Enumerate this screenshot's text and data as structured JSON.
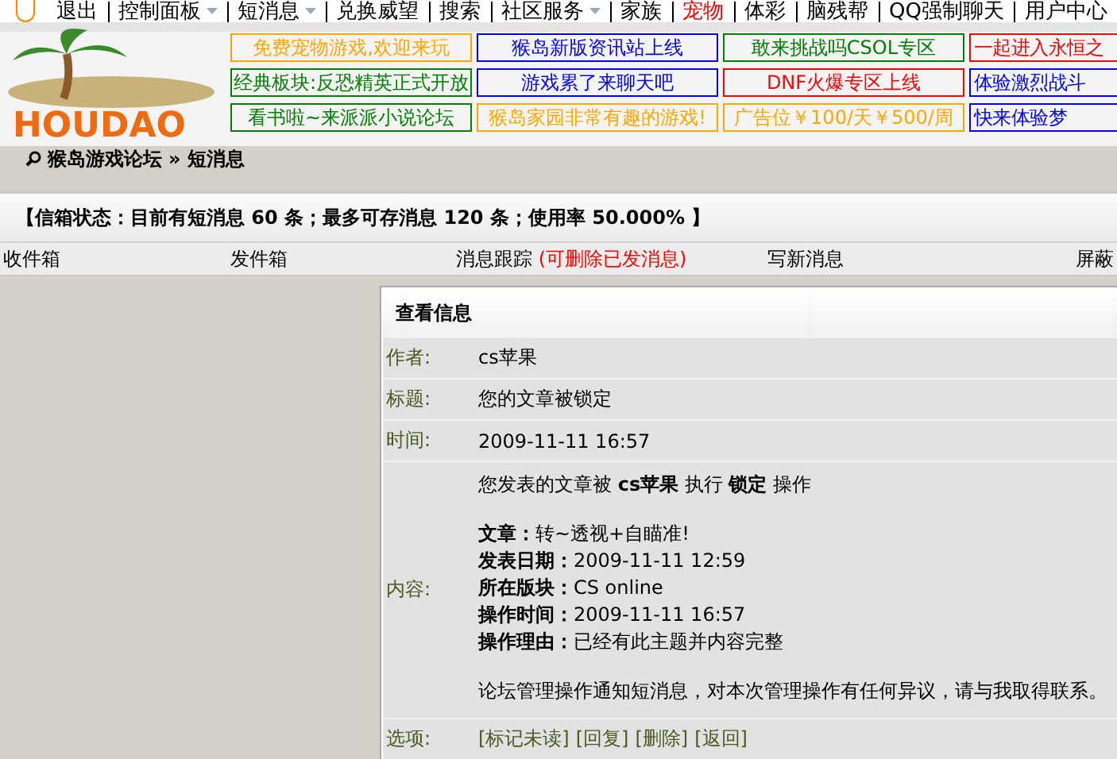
{
  "top_nav": [
    {
      "label": "退出",
      "has_menu": false,
      "highlighted": false
    },
    {
      "label": "控制面板",
      "has_menu": true,
      "highlighted": false
    },
    {
      "label": "短消息",
      "has_menu": true,
      "highlighted": false
    },
    {
      "label": "兑换威望",
      "has_menu": false,
      "highlighted": false
    },
    {
      "label": "搜索",
      "has_menu": false,
      "highlighted": false
    },
    {
      "label": "社区服务",
      "has_menu": true,
      "highlighted": false
    },
    {
      "label": "家族",
      "has_menu": false,
      "highlighted": false
    },
    {
      "label": "宠物",
      "has_menu": false,
      "highlighted": true
    },
    {
      "label": "体彩",
      "has_menu": false,
      "highlighted": false
    },
    {
      "label": "脑残帮",
      "has_menu": false,
      "highlighted": false
    },
    {
      "label": "QQ强制聊天",
      "has_menu": false,
      "highlighted": false
    },
    {
      "label": "用户中心",
      "has_menu": false,
      "highlighted": false
    }
  ],
  "logo": {
    "text": "HOUDAO"
  },
  "ads": [
    {
      "text": "免费宠物游戏,欢迎来玩",
      "color": "#ffa500"
    },
    {
      "text": "猴岛新版资讯站上线",
      "color": "#0000ff"
    },
    {
      "text": "敢来挑战吗CSOL专区",
      "color": "#008000"
    },
    {
      "text": "一起进入永恒之",
      "color": "#ff0000"
    },
    {
      "text": "经典板块:反恐精英正式开放",
      "color": "#008000"
    },
    {
      "text": "游戏累了来聊天吧",
      "color": "#0000ff"
    },
    {
      "text": "DNF火爆专区上线",
      "color": "#ff0000"
    },
    {
      "text": "体验激烈战斗",
      "color": "#0000ff"
    },
    {
      "text": "看书啦~来派派小说论坛",
      "color": "#008000"
    },
    {
      "text": "猴岛家园非常有趣的游戏!",
      "color": "#ffa500"
    },
    {
      "text": "广告位￥100/天￥500/周",
      "color": "#ffa500"
    },
    {
      "text": "快来体验梦",
      "color": "#0000ff"
    }
  ],
  "breadcrumb": [
    "猴岛游戏论坛",
    "»",
    "短消息"
  ],
  "status": "【信箱状态：目前有短消息 60 条；最多可存消息 120 条；使用率 50.000% 】",
  "tabs": [
    {
      "label": "收件箱"
    },
    {
      "label": "发件箱"
    },
    {
      "label": "消息跟踪",
      "note": "(可删除已发消息)"
    },
    {
      "label": "写新消息"
    },
    {
      "label": "屏蔽"
    }
  ],
  "message": {
    "title": "查看信息",
    "fields": [
      {
        "label": "作者:",
        "value": "cs苹果"
      },
      {
        "label": "标题:",
        "value": "您的文章被锁定"
      },
      {
        "label": "时间:",
        "value": "2009-11-11 16:57"
      }
    ],
    "content_label": "内容:",
    "content": [
      [
        "您发表的文章被 **cs苹果** 执行 **锁定** 操作"
      ],
      [
        "**文章：**转~透视+自瞄准!",
        "**发表日期：**2009-11-11 12:59",
        "**所在版块：**CS online",
        "**操作时间：**2009-11-11 16:57",
        "**操作理由：**已经有此主题并内容完整"
      ],
      [
        "论坛管理操作通知短消息，对本次管理操作有任何异议，请与我取得联系。"
      ]
    ],
    "options_label": "选项:",
    "options": [
      "[标记未读]",
      "[回复]",
      "[删除]",
      "[返回]"
    ]
  }
}
